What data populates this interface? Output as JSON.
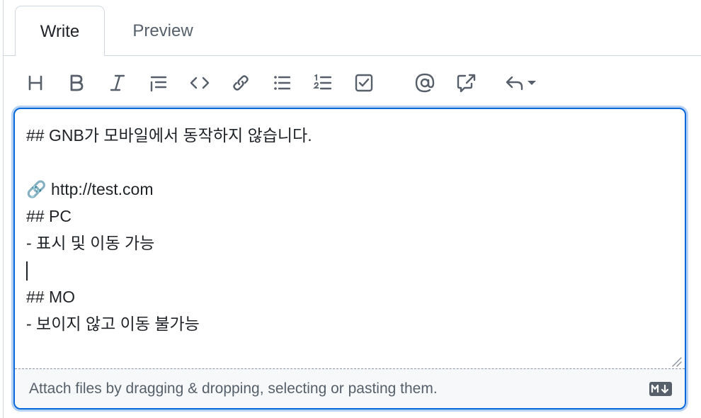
{
  "tabs": [
    {
      "label": "Write",
      "active": true
    },
    {
      "label": "Preview",
      "active": false
    }
  ],
  "toolbar": {
    "icons": [
      "heading-icon",
      "bold-icon",
      "italic-icon",
      "quote-icon",
      "code-icon",
      "link-icon",
      "bulleted-list-icon",
      "numbered-list-icon",
      "task-list-icon",
      "mention-icon",
      "cross-reference-icon",
      "reply-icon"
    ]
  },
  "editor": {
    "lines": [
      "## GNB가 모바일에서 동작하지 않습니다.",
      "",
      "🔗 http://test.com",
      "## PC",
      "- 표시 및 이동 가능",
      "",
      "## MO",
      "- 보이지 않고 이동 불가능"
    ]
  },
  "attach": {
    "text": "Attach files by dragging & dropping, selecting or pasting them."
  },
  "colors": {
    "accent": "#0969da",
    "border": "#d0d7de",
    "icon": "#57606a",
    "text": "#1f2328"
  }
}
